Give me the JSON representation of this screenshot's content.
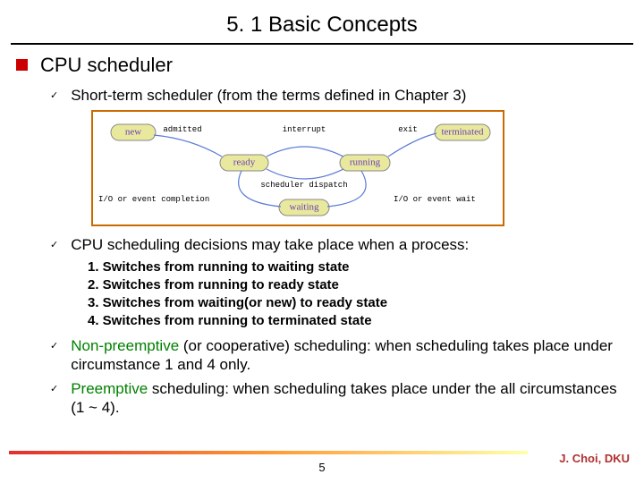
{
  "title": "5. 1 Basic Concepts",
  "heading": "CPU scheduler",
  "points": {
    "p1": "Short-term scheduler (from the terms defined in Chapter 3)",
    "p2": "CPU scheduling decisions may take place when a process:",
    "p3a": "Non-preemptive",
    "p3b": " (or cooperative) scheduling: when scheduling takes place under circumstance 1 and 4 only.",
    "p4a": "Preemptive",
    "p4b": " scheduling: when scheduling takes place under the all circumstances (1 ~ 4)."
  },
  "sublist": {
    "s1": "1. Switches from running to waiting state",
    "s2": "2. Switches from running to ready state",
    "s3": "3. Switches from waiting(or new) to ready state",
    "s4": "4. Switches from running to terminated state"
  },
  "diagram": {
    "nodes": {
      "new": "new",
      "ready": "ready",
      "running": "running",
      "waiting": "waiting",
      "terminated": "terminated"
    },
    "edges": {
      "admitted": "admitted",
      "interrupt": "interrupt",
      "exit": "exit",
      "dispatch": "scheduler dispatch",
      "iowait": "I/O or event wait",
      "iocomp": "I/O or event completion"
    }
  },
  "page": "5",
  "author": "J. Choi, DKU"
}
